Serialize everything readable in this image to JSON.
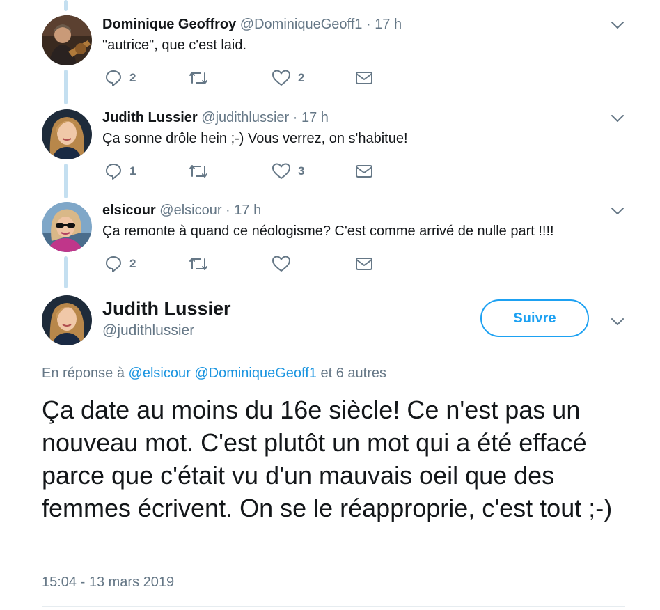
{
  "replies": [
    {
      "name": "Dominique Geoffroy",
      "handle": "@DominiqueGeoff1",
      "dot": "·",
      "time": "17 h",
      "text": "\"autrice\", que c'est laid.",
      "reply_count": "2",
      "retweet_count": "",
      "like_count": "2"
    },
    {
      "name": "Judith Lussier",
      "handle": "@judithlussier",
      "dot": "·",
      "time": "17 h",
      "text": "Ça sonne drôle hein ;-) Vous verrez, on s'habitue!",
      "reply_count": "1",
      "retweet_count": "",
      "like_count": "3"
    },
    {
      "name": "elsicour",
      "handle": "@elsicour",
      "dot": "·",
      "time": "17 h",
      "text": "Ça remonte à quand ce néologisme? C'est comme arrivé de nulle part !!!!",
      "reply_count": "2",
      "retweet_count": "",
      "like_count": ""
    }
  ],
  "main_tweet": {
    "name": "Judith Lussier",
    "handle": "@judithlussier",
    "follow_label": "Suivre",
    "reply_prefix": "En réponse à",
    "mention1": "@elsicour",
    "mention2": "@DominiqueGeoff1",
    "reply_suffix": "et 6 autres",
    "text": "Ça date au moins du 16e siècle! Ce n'est pas un nouveau mot. C'est plutôt un mot qui a été effacé parce que c'était vu d'un mauvais oeil que des femmes écrivent. On se le réapproprie, c'est tout ;-)",
    "timestamp": "15:04 - 13 mars 2019"
  },
  "colors": {
    "accent": "#1da1f2",
    "mention": "#1b95e0",
    "muted": "#657786",
    "thread_line": "#c4dff0"
  },
  "icons": [
    "reply-icon",
    "retweet-icon",
    "like-icon",
    "message-icon",
    "chevron-down-icon"
  ]
}
